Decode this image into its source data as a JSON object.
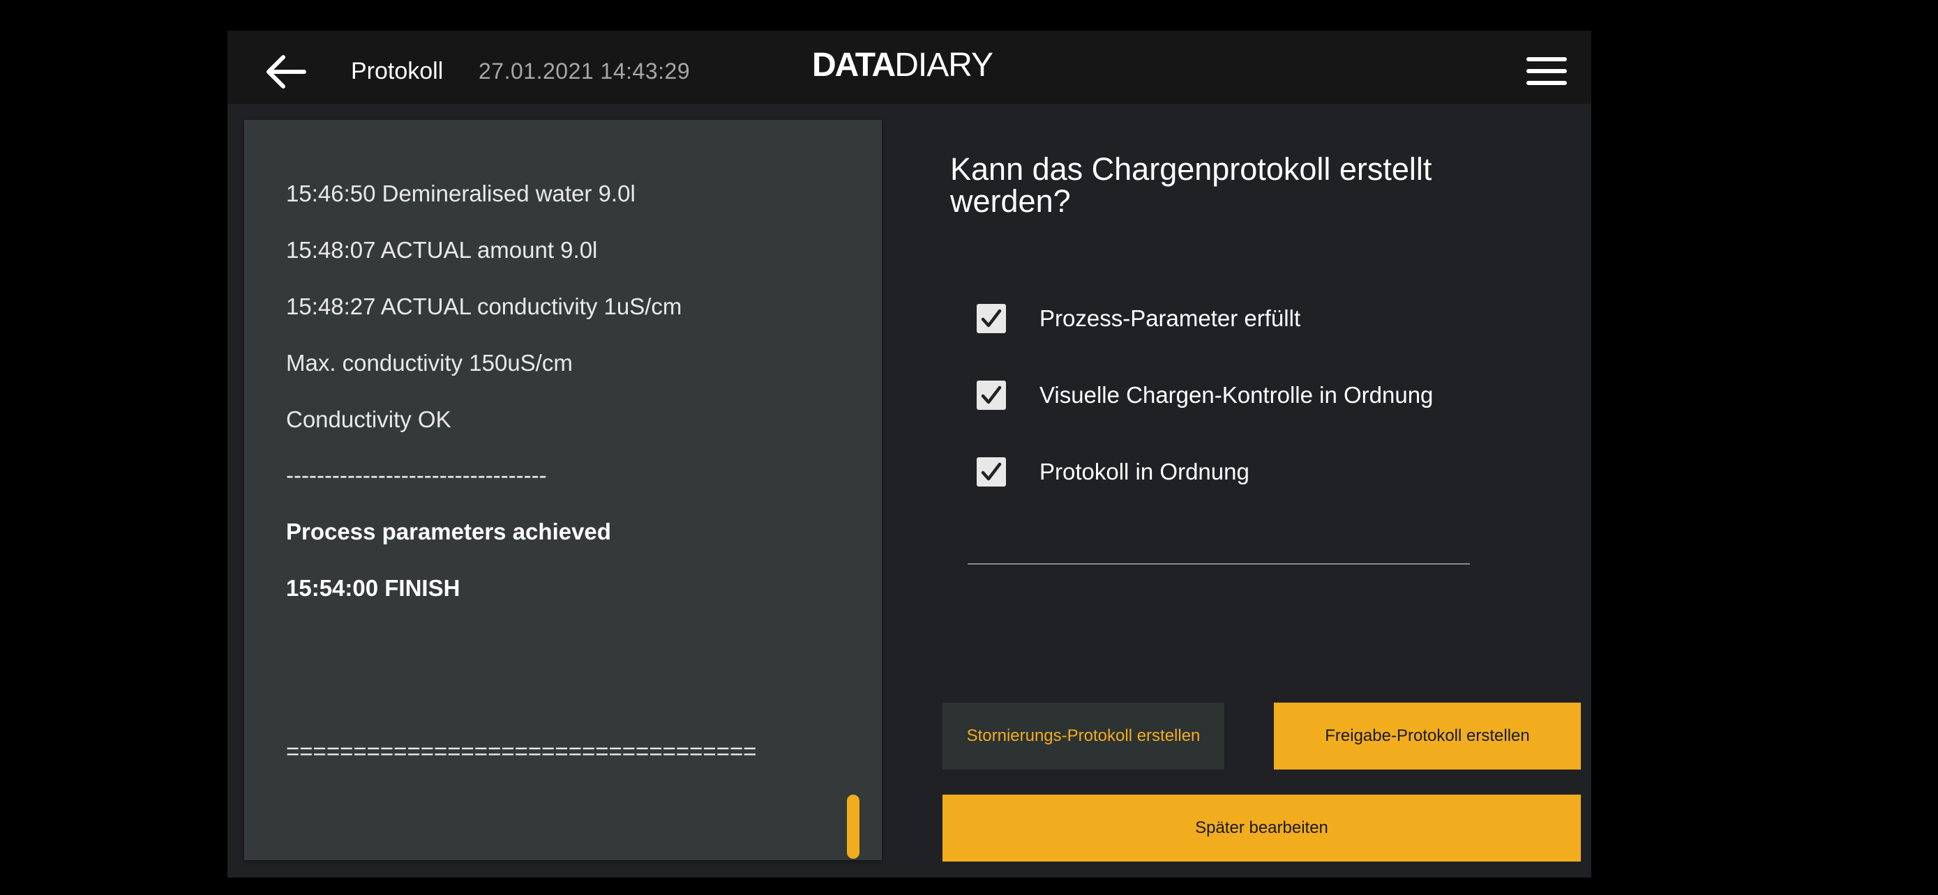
{
  "header": {
    "back_icon": "arrow-left-icon",
    "title": "Protokoll",
    "timestamp": "27.01.2021 14:43:29",
    "logo_bold": "DATA",
    "logo_light": "DIARY",
    "menu_icon": "hamburger-menu-icon"
  },
  "log": {
    "lines": [
      "15:46:50 Demineralised water 9.0l",
      "15:48:07 ACTUAL amount 9.0l",
      "15:48:27 ACTUAL conductivity 1uS/cm",
      "Max. conductivity 150uS/cm",
      "Conductivity OK",
      "----------------------------------",
      "Process parameters achieved",
      "15:54:00 FINISH",
      "==================================="
    ]
  },
  "dialog": {
    "question": "Kann das Chargenprotokoll erstellt werden?",
    "checks": [
      {
        "label": "Prozess-Parameter erfüllt",
        "checked": true
      },
      {
        "label": "Visuelle Chargen-Kontrolle in Ordnung",
        "checked": true
      },
      {
        "label": "Protokoll in Ordnung",
        "checked": true
      }
    ]
  },
  "actions": {
    "cancel_label": "Stornierungs-Protokoll erstellen",
    "release_label": "Freigabe-Protokoll erstellen",
    "later_label": "Später bearbeiten"
  },
  "colors": {
    "accent": "#f2ad1f",
    "background": "#202124",
    "header": "#161616",
    "log_panel": "#343a3a"
  }
}
